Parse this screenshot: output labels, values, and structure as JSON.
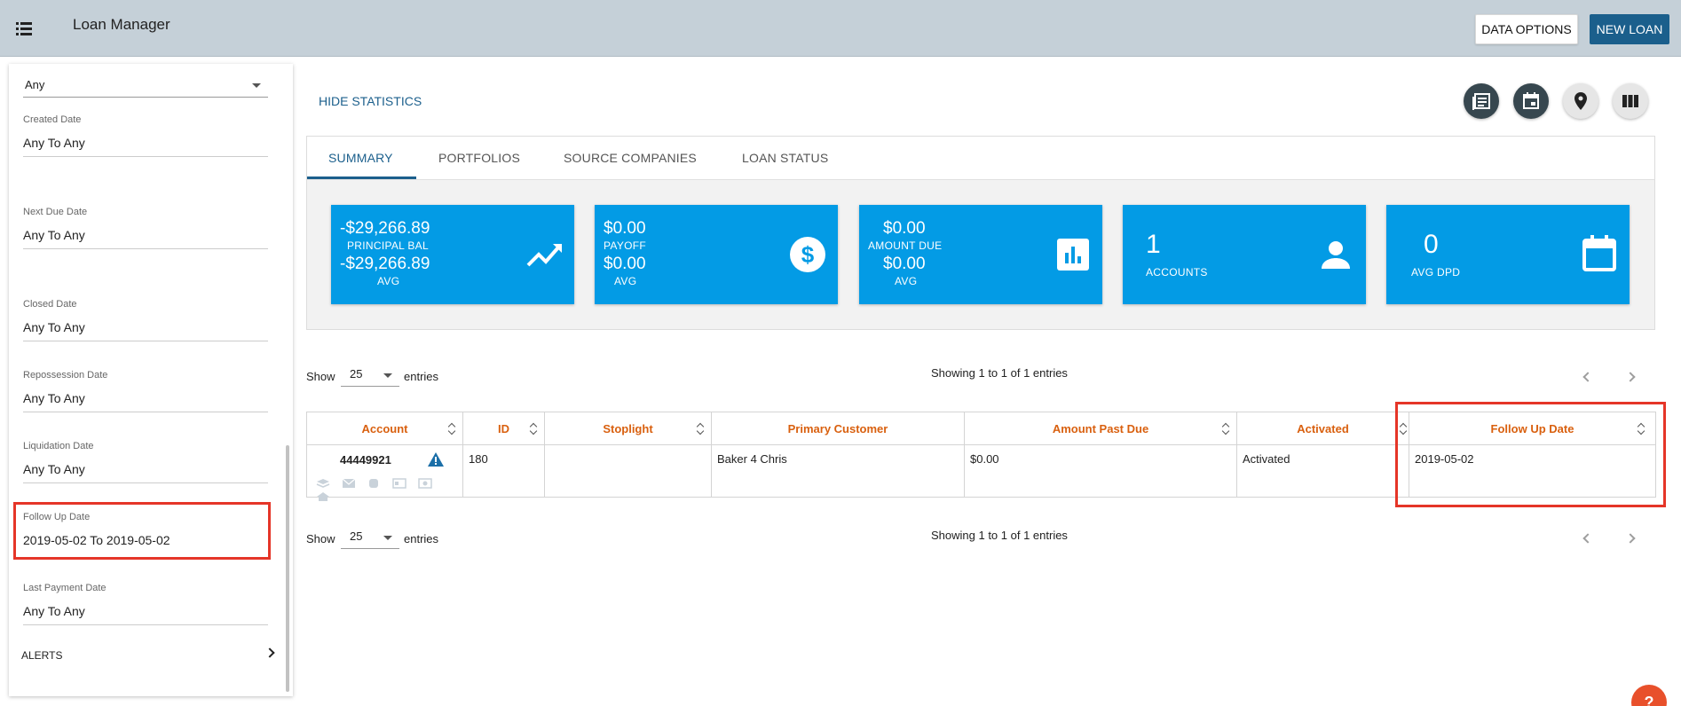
{
  "header": {
    "title": "Loan Manager",
    "data_options_label": "DATA OPTIONS",
    "new_loan_label": "NEW LOAN"
  },
  "sidebar": {
    "status_select_value": "Any",
    "filters": [
      {
        "label": "Created Date",
        "value": "Any To Any"
      },
      {
        "label": "Next Due Date",
        "value": "Any To Any"
      },
      {
        "label": "Closed Date",
        "value": "Any To Any"
      },
      {
        "label": "Repossession Date",
        "value": "Any To Any"
      },
      {
        "label": "Liquidation Date",
        "value": "Any To Any"
      },
      {
        "label": "Follow Up Date",
        "value": "2019-05-02 To 2019-05-02"
      },
      {
        "label": "Last Payment Date",
        "value": "Any To Any"
      }
    ],
    "alerts_label": "ALERTS"
  },
  "main": {
    "hide_statistics_label": "HIDE STATISTICS",
    "tabs": [
      {
        "label": "SUMMARY"
      },
      {
        "label": "PORTFOLIOS"
      },
      {
        "label": "SOURCE COMPANIES"
      },
      {
        "label": "LOAN STATUS"
      }
    ],
    "cards": [
      {
        "value": "-$29,266.89",
        "label": "PRINCIPAL BAL",
        "avg_value": "-$29,266.89",
        "avg_label": "AVG",
        "icon": "trending-up-icon"
      },
      {
        "value": "$0.00",
        "label": "PAYOFF",
        "avg_value": "$0.00",
        "avg_label": "AVG",
        "icon": "dollar-circle-icon"
      },
      {
        "value": "$0.00",
        "label": "AMOUNT DUE",
        "avg_value": "$0.00",
        "avg_label": "AVG",
        "icon": "bar-chart-icon"
      },
      {
        "value": "1",
        "label": "ACCOUNTS",
        "icon": "person-icon"
      },
      {
        "value": "0",
        "label": "AVG DPD",
        "icon": "calendar-icon"
      }
    ],
    "card_color": "#039be5",
    "table_top": {
      "show_label": "Show",
      "entries_value": "25",
      "entries_label": "entries",
      "info": "Showing 1 to 1 of 1 entries"
    },
    "table_bottom": {
      "show_label": "Show",
      "entries_value": "25",
      "entries_label": "entries",
      "info": "Showing 1 to 1 of 1 entries"
    },
    "columns": [
      "Account",
      "ID",
      "Stoplight",
      "Primary Customer",
      "Amount Past Due",
      "Activated",
      "Follow Up Date"
    ],
    "rows": [
      {
        "account": "44449921",
        "id": "180",
        "stoplight": "",
        "primary_customer": "Baker 4 Chris",
        "amount_past_due": "$0.00",
        "activated": "Activated",
        "follow_up_date": "2019-05-02"
      }
    ],
    "header_color": "#d9600f"
  },
  "help_label": "?"
}
